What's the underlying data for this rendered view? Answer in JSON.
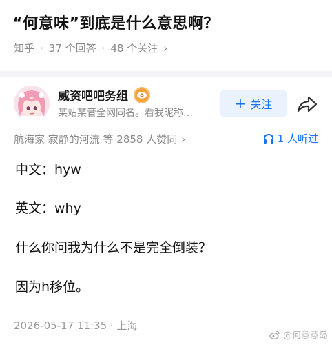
{
  "question": {
    "title": "“何意味”到底是什么意思啊？",
    "source": "知乎",
    "answers": "37 个回答",
    "followers": "48 个关注",
    "separator": "·",
    "chevron": "›"
  },
  "answer": {
    "author_name": "威资吧吧务组",
    "author_bio": "某站某音全网同名。看我昵称…",
    "follow_label": "关注",
    "follow_plus": "+",
    "approvals": "航海家 寂静的河流 等 2858 人赞同",
    "approvals_chevron": "›",
    "listen_label": "1 人听过",
    "lines": [
      "中文：hyw",
      "英文：why",
      "什么你问我为什么不是完全倒装？",
      "因为h移位。"
    ],
    "footer": "2026-05-17 11:35 · 上海"
  },
  "watermark": "@何意意岛",
  "colors": {
    "accent": "#1772f6",
    "follow_bg": "#eaf2fe",
    "badge": "#f7a23b",
    "meta": "#8a8a8a"
  }
}
